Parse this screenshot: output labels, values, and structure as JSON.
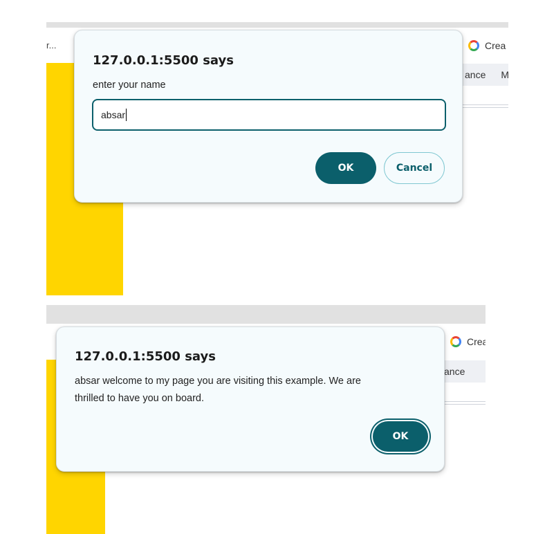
{
  "colors": {
    "accent": "#0b5f6b",
    "page_yellow": "#ffd500",
    "dialog_bg": "#f5fbfd"
  },
  "background": {
    "tab_truncated_text": "r...",
    "bookmark_google_label": "Crea",
    "bookmark_google_icon": "google-g-icon",
    "tab_items_top": [
      "ance",
      "M"
    ],
    "tab_items_bottom": [
      "ance"
    ]
  },
  "prompt_dialog": {
    "title": "127.0.0.1:5500 says",
    "message": "enter your name",
    "input_value": "absar",
    "ok_label": "OK",
    "cancel_label": "Cancel"
  },
  "alert_dialog": {
    "title": "127.0.0.1:5500 says",
    "message_line1": "absar welcome to my page you are visiting this example. We are",
    "message_line2": "thrilled to have you on board.",
    "ok_label": "OK"
  }
}
